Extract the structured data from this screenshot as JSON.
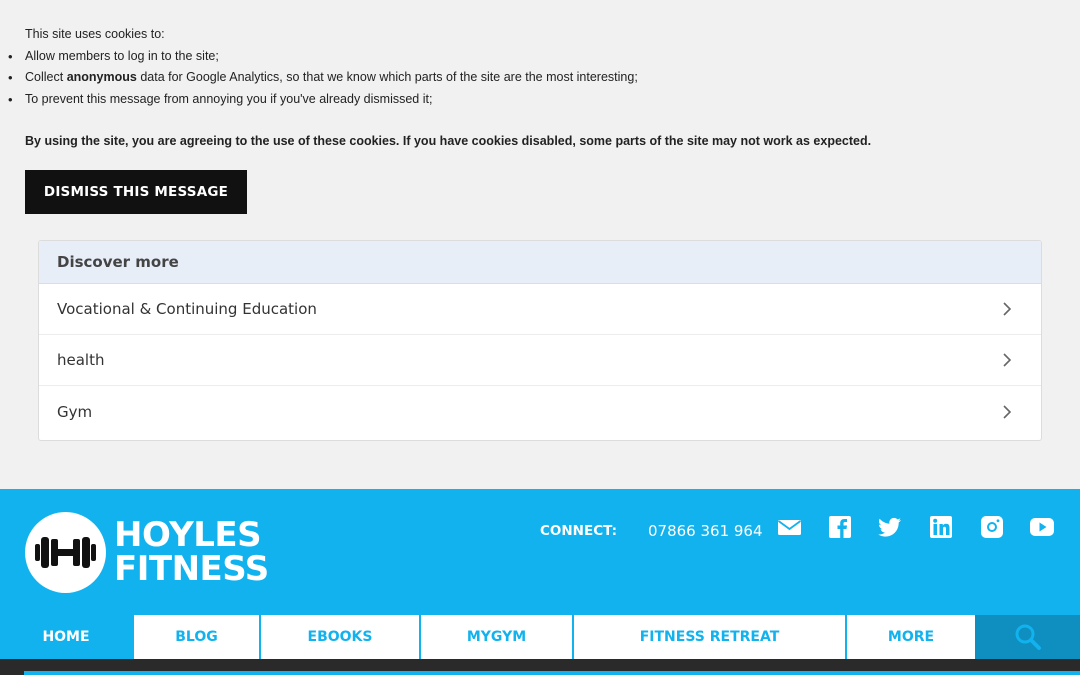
{
  "cookie": {
    "intro": "This site uses cookies to:",
    "bullet1": "Allow members to log in to the site;",
    "bullet2_pre": "Collect ",
    "bullet2_bold": "anonymous",
    "bullet2_post": " data for Google Analytics, so that we know which parts of the site are the most interesting;",
    "bullet3": "To prevent this message from annoying you if you've already dismissed it;",
    "agree": "By using the site, you are agreeing to the use of these cookies. If you have cookies disabled, some parts of the site may not work as expected.",
    "dismiss_label": "DISMISS THIS MESSAGE"
  },
  "discover": {
    "title": "Discover more",
    "items": [
      {
        "label": "Vocational & Continuing Education"
      },
      {
        "label": "health"
      },
      {
        "label": "Gym"
      }
    ]
  },
  "footer": {
    "brand_line1": "HOYLES",
    "brand_line2": "FITNESS",
    "connect_label": "CONNECT:",
    "phone": "07866 361 964",
    "social_icons": [
      "mail-icon",
      "facebook-icon",
      "twitter-icon",
      "linkedin-icon",
      "instagram-icon",
      "youtube-icon"
    ]
  },
  "nav": {
    "items": [
      {
        "label": "HOME"
      },
      {
        "label": "BLOG"
      },
      {
        "label": "EBOOKS"
      },
      {
        "label": "MYGYM"
      },
      {
        "label": "FITNESS RETREAT"
      },
      {
        "label": "MORE"
      }
    ]
  },
  "colors": {
    "brand_blue": "#11b2ee",
    "search_bg": "#0f8ec0",
    "dismiss_bg": "#111111",
    "discover_header_bg": "#e8eef8",
    "page_bg": "#f1f1f1"
  }
}
